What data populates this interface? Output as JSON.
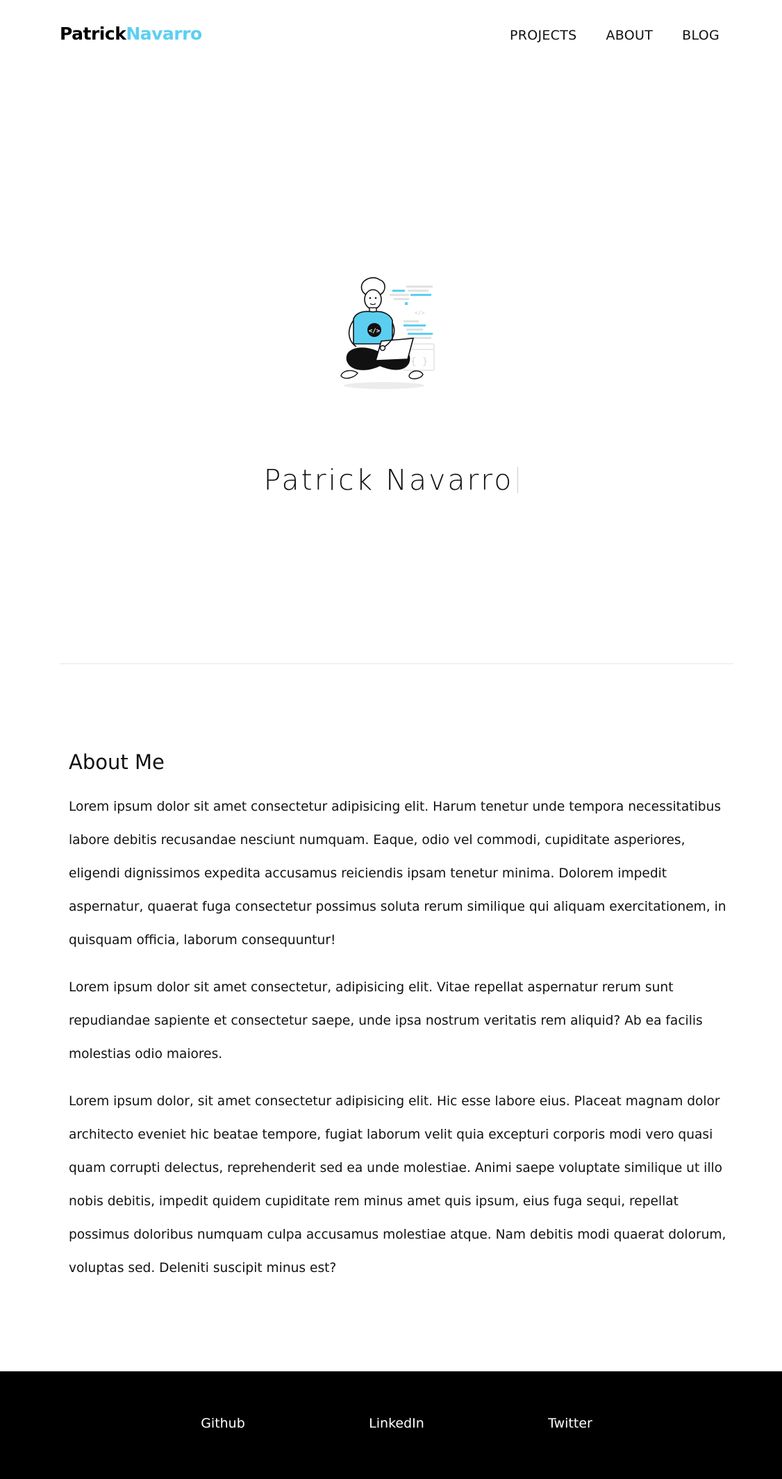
{
  "header": {
    "logo_first": "Patrick",
    "logo_last": "Navarro",
    "nav": [
      "PROJECTS",
      "ABOUT",
      "BLOG"
    ]
  },
  "hero": {
    "illustration": "developer-with-laptop-illustration",
    "title": "Patrick Navarro"
  },
  "about": {
    "heading": "About Me",
    "paragraphs": [
      "Lorem ipsum dolor sit amet consectetur adipisicing elit. Harum tenetur unde tempora necessitatibus labore debitis recusandae nesciunt numquam. Eaque, odio vel commodi, cupiditate asperiores, eligendi dignissimos expedita accusamus reiciendis ipsam tenetur minima. Dolorem impedit aspernatur, quaerat fuga consectetur possimus soluta rerum similique qui aliquam exercitationem, in quisquam officia, laborum consequuntur!",
      "Lorem ipsum dolor sit amet consectetur, adipisicing elit. Vitae repellat aspernatur rerum sunt repudiandae sapiente et consectetur saepe, unde ipsa nostrum veritatis rem aliquid? Ab ea facilis molestias odio maiores.",
      "Lorem ipsum dolor, sit amet consectetur adipisicing elit. Hic esse labore eius. Placeat magnam dolor architecto eveniet hic beatae tempore, fugiat laborum velit quia excepturi corporis modi vero quasi quam corrupti delectus, reprehenderit sed ea unde molestiae. Animi saepe voluptate similique ut illo nobis debitis, impedit quidem cupiditate rem minus amet quis ipsum, eius fuga sequi, repellat possimus doloribus numquam culpa accusamus molestiae atque. Nam debitis modi quaerat dolorum, voluptas sed. Deleniti suscipit minus est?"
    ]
  },
  "footer": {
    "links": [
      "Github",
      "LinkedIn",
      "Twitter"
    ]
  },
  "colors": {
    "accent": "#5ccff1",
    "footer_bg": "#000000"
  }
}
